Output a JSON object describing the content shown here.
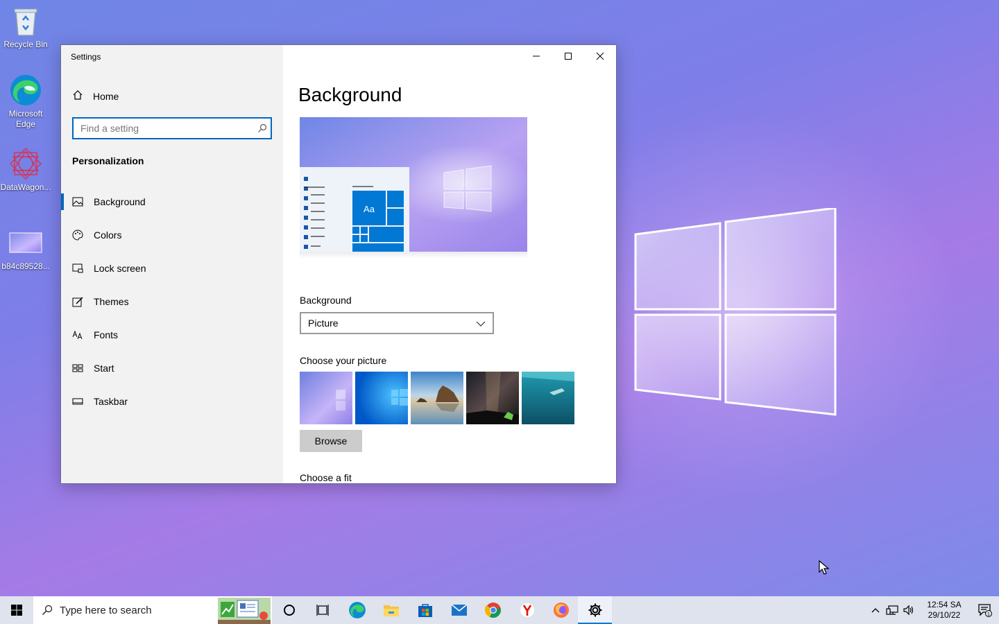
{
  "desktop": {
    "icons": [
      {
        "label": "Recycle Bin",
        "icon": "recycle-bin-icon"
      },
      {
        "label": "Microsoft Edge",
        "icon": "edge-icon"
      },
      {
        "label": "DataWagon...",
        "icon": "datawagon-icon"
      },
      {
        "label": "b84c89528...",
        "icon": "image-file-icon"
      }
    ]
  },
  "settings": {
    "window_title": "Settings",
    "home_label": "Home",
    "search_placeholder": "Find a setting",
    "section_heading": "Personalization",
    "nav_items": [
      {
        "label": "Background",
        "icon": "picture-icon",
        "active": true
      },
      {
        "label": "Colors",
        "icon": "palette-icon",
        "active": false
      },
      {
        "label": "Lock screen",
        "icon": "lock-screen-icon",
        "active": false
      },
      {
        "label": "Themes",
        "icon": "themes-brush-icon",
        "active": false
      },
      {
        "label": "Fonts",
        "icon": "fonts-icon",
        "active": false
      },
      {
        "label": "Start",
        "icon": "start-tiles-icon",
        "active": false
      },
      {
        "label": "Taskbar",
        "icon": "taskbar-icon",
        "active": false
      }
    ],
    "page_title": "Background",
    "preview_tile_text": "Aa",
    "background_label": "Background",
    "background_value": "Picture",
    "choose_picture_label": "Choose your picture",
    "browse_label": "Browse",
    "choose_fit_label": "Choose a fit"
  },
  "taskbar": {
    "search_placeholder": "Type here to search",
    "pinned": [
      "cortana-icon",
      "task-view-icon",
      "edge-icon",
      "file-explorer-icon",
      "store-icon",
      "mail-icon",
      "chrome-icon",
      "yandex-icon",
      "firefox-icon",
      "settings-gear-icon"
    ],
    "clock_time": "12:54 SA",
    "clock_date": "29/10/22",
    "notification_count": "1"
  },
  "colors": {
    "accent": "#0067c0",
    "sidebar_bg": "#f2f2f2",
    "taskbar_bg": "#dfe3ee"
  }
}
